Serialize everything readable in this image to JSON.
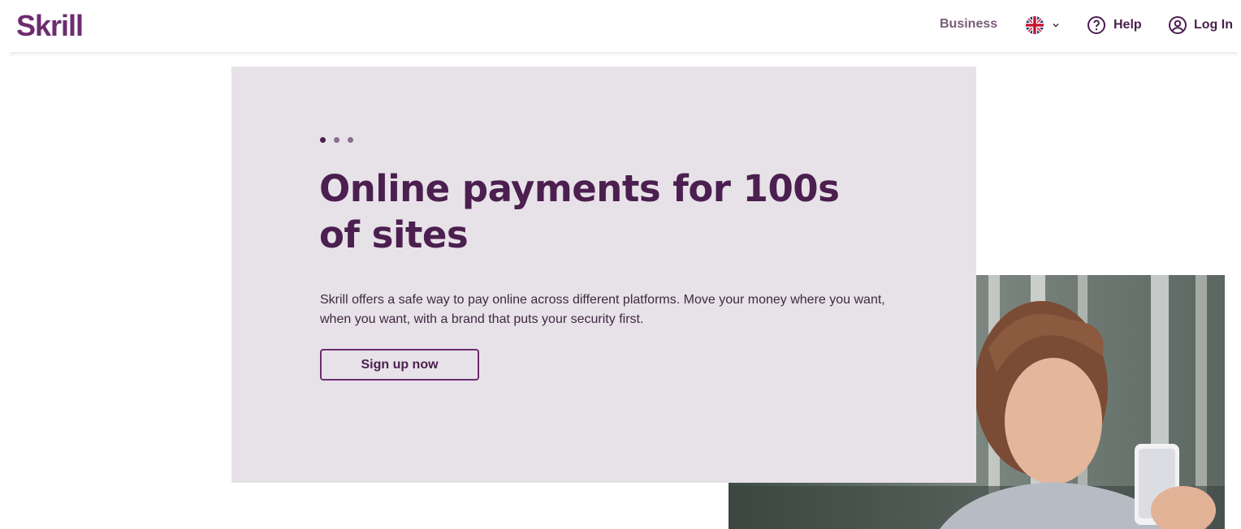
{
  "header": {
    "logo": "Skrill",
    "business_label": "Business",
    "language": {
      "flag_icon": "uk-flag-icon",
      "chevron_icon": "chevron-down-icon"
    },
    "help_label": "Help",
    "help_icon": "help-circle-icon",
    "login_label": "Log In",
    "login_icon": "user-circle-icon"
  },
  "hero": {
    "carousel_dots": 3,
    "title": "Online payments for 100s of sites",
    "description": "Skrill offers a safe way to pay online across different platforms. Move your money where you want, when you want, with a brand that puts your security first.",
    "cta_label": "Sign up now"
  },
  "colors": {
    "brand": "#6d2d6f",
    "text": "#4b1f4f",
    "card_bg": "#e7e2e8"
  }
}
